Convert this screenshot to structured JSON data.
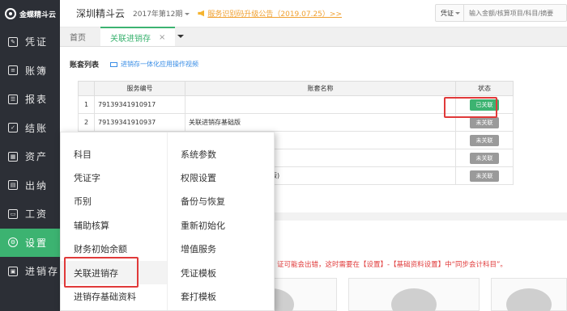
{
  "app": {
    "logo_text": "金蝶精斗云"
  },
  "sidebar": {
    "items": [
      {
        "label": "凭证",
        "icon": "voucher-icon"
      },
      {
        "label": "账簿",
        "icon": "ledger-icon"
      },
      {
        "label": "报表",
        "icon": "report-icon"
      },
      {
        "label": "结账",
        "icon": "checkout-icon"
      },
      {
        "label": "资产",
        "icon": "asset-icon"
      },
      {
        "label": "出纳",
        "icon": "cashier-icon"
      },
      {
        "label": "工资",
        "icon": "salary-icon"
      },
      {
        "label": "设置",
        "icon": "gear-icon",
        "active": true
      },
      {
        "label": "进销存",
        "icon": "inventory-icon"
      }
    ]
  },
  "header": {
    "company": "深圳精斗云",
    "period": "2017年第12期",
    "notice": "服务识别码升级公告（2019.07.25）>>",
    "search_type": "凭证",
    "search_placeholder": "输入金额/核算项目/科目/摘要"
  },
  "tabs": [
    {
      "label": "首页"
    },
    {
      "label": "关联进销存",
      "active": true,
      "close": "×"
    }
  ],
  "content": {
    "list_title": "账套列表",
    "video_link": "进销存一体化应用操作视频",
    "table": {
      "headers": [
        "",
        "服务编号",
        "账套名称",
        "状态"
      ],
      "rows": [
        {
          "idx": "1",
          "code": "79139341910917",
          "name": "",
          "status": "已关联"
        },
        {
          "idx": "2",
          "code": "79139341910937",
          "name": "关联进销存基础版",
          "status": "未关联"
        },
        {
          "idx": "",
          "code": "",
          "name": "",
          "status": "未关联"
        },
        {
          "idx": "",
          "code": "",
          "name": "",
          "status": "未关联"
        },
        {
          "idx": "",
          "code": "",
          "name": "版)",
          "status": "未关联"
        }
      ]
    },
    "warning": "证可能会出错，这时需要在【设置】-【基础资料设置】中“同步会计科目”。"
  },
  "menu": {
    "left": [
      "科目",
      "凭证字",
      "币别",
      "辅助核算",
      "财务初始余额",
      "关联进销存",
      "进销存基础资料"
    ],
    "right": [
      "系统参数",
      "权限设置",
      "备份与恢复",
      "重新初始化",
      "增值服务",
      "凭证模板",
      "套打模板"
    ]
  },
  "colors": {
    "accent": "#3cb371",
    "sidebar_bg": "#2c2f36",
    "highlight": "#e03a3a",
    "notice": "#f0a030",
    "link": "#3a8ee6"
  }
}
